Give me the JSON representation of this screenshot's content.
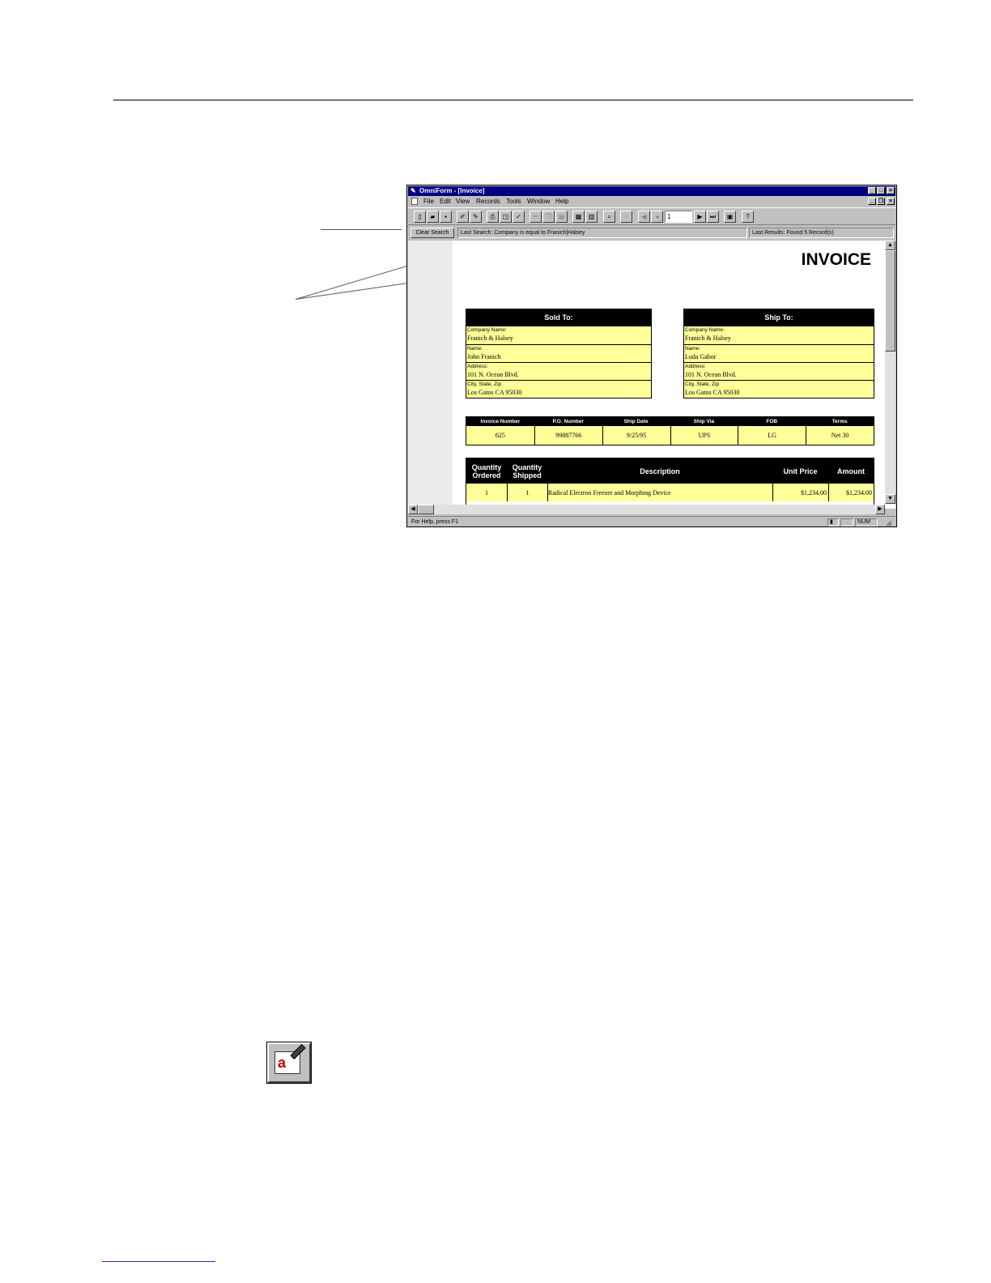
{
  "window": {
    "title": "OmniForm - [Invoice]",
    "menu": [
      "File",
      "Edit",
      "View",
      "Records",
      "Tools",
      "Window",
      "Help"
    ],
    "record_number": "1",
    "search": {
      "clear_label": "Clear Search",
      "last_search": "Last Search:  Company is equal to Franich|Halsey",
      "last_results": "Last Results:  Found 5 Record(s)"
    },
    "status": {
      "help_text": "For Help, press F1",
      "num": "NUM"
    }
  },
  "invoice": {
    "title": "INVOICE",
    "sold_to": {
      "header": "Sold To:",
      "fields": [
        {
          "label": "Company Name:",
          "value": "Franich & Halsey"
        },
        {
          "label": "Name:",
          "value": "John Franich"
        },
        {
          "label": "Address:",
          "value": "101 N. Ocean Blvd."
        },
        {
          "label": "City, State, Zip",
          "value": "Los Gatos CA 95030"
        }
      ]
    },
    "ship_to": {
      "header": "Ship To:",
      "fields": [
        {
          "label": "Company Name:",
          "value": "Franich & Halsey"
        },
        {
          "label": "Name:",
          "value": "Luda Gabor"
        },
        {
          "label": "Address:",
          "value": "101 N. Ocean Blvd."
        },
        {
          "label": "City, State, Zip",
          "value": "Los Gatos CA 95030"
        }
      ]
    },
    "info": {
      "headers": [
        "Invoice Number",
        "P.O. Number",
        "Ship Date",
        "Ship Via",
        "FOB",
        "Terms"
      ],
      "values": [
        "625",
        "99887766",
        "9/25/95",
        "UPS",
        "LG",
        "Net 30"
      ]
    },
    "items": {
      "headers": [
        "Quantity Ordered",
        "Quantity Shipped",
        "Description",
        "Unit Price",
        "Amount"
      ],
      "rows": [
        [
          "1",
          "1",
          "Radical Electron Freezer and Morphing Device",
          "$1,234.00",
          "$1,234.00"
        ]
      ]
    }
  }
}
